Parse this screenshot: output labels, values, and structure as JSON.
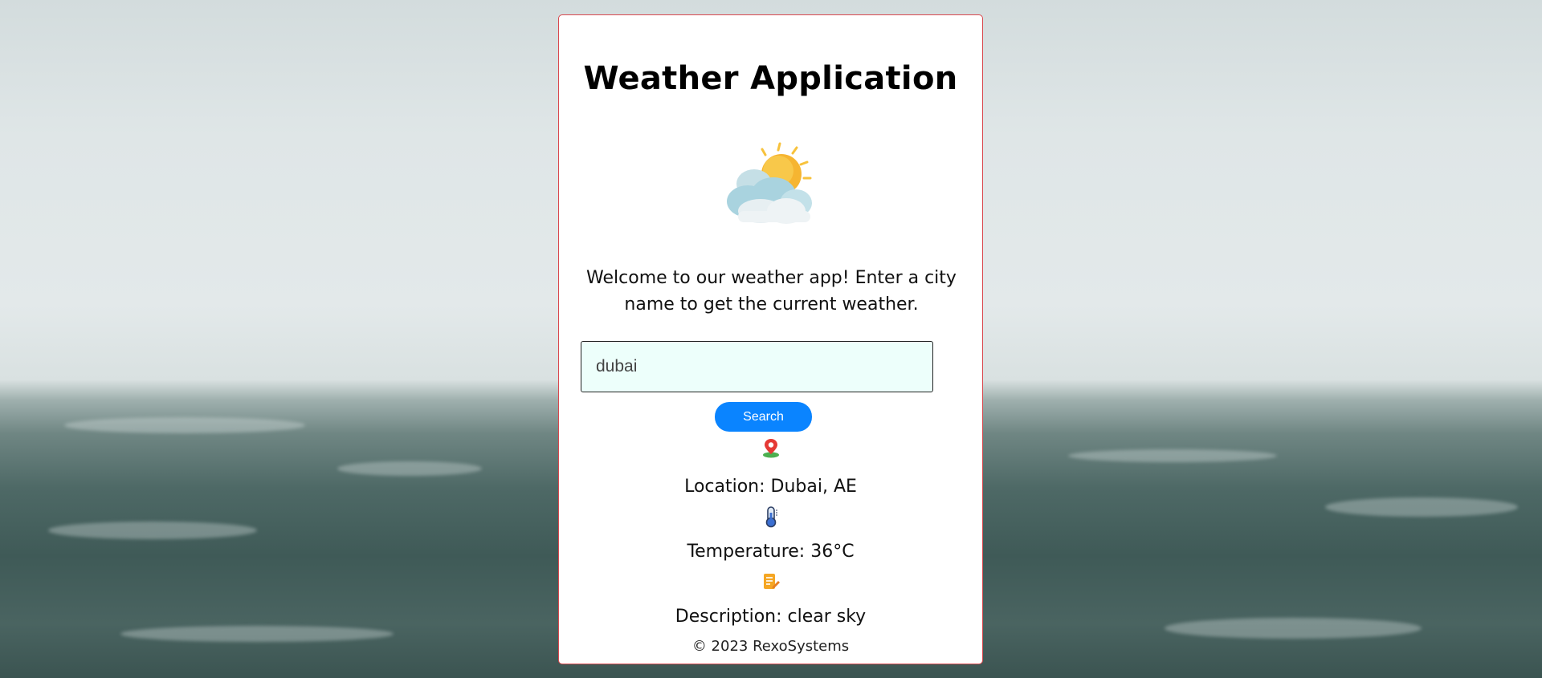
{
  "app": {
    "title": "Weather Application",
    "welcome_text": "Welcome to our weather app! Enter a city name to get the current weather."
  },
  "icons": {
    "hero": "sun-cloud-icon",
    "location": "map-pin-icon",
    "temperature": "thermometer-icon",
    "description": "note-icon"
  },
  "search": {
    "value": "dubai",
    "placeholder": "",
    "button_label": "Search"
  },
  "result": {
    "location_text": "Location: Dubai, AE",
    "temperature_text": "Temperature: 36°C",
    "description_text": "Description: clear sky"
  },
  "footer": {
    "text": "© 2023 RexoSystems"
  },
  "colors": {
    "card_border": "#d9484e",
    "input_background": "#edfffb",
    "button_background": "#0a84ff"
  }
}
